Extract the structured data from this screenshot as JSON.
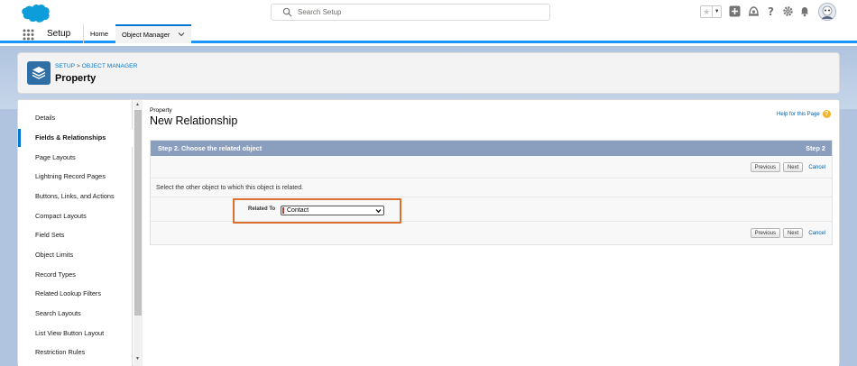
{
  "search": {
    "placeholder": "Search Setup"
  },
  "nav": {
    "app_name": "Setup",
    "tabs": [
      {
        "label": "Home"
      },
      {
        "label": "Object Manager"
      }
    ]
  },
  "header": {
    "breadcrumb_setup": "SETUP",
    "breadcrumb_sep": ">",
    "breadcrumb_om": "OBJECT MANAGER",
    "object_name": "Property"
  },
  "sidebar": {
    "items": [
      {
        "label": "Details"
      },
      {
        "label": "Fields & Relationships",
        "active": true
      },
      {
        "label": "Page Layouts"
      },
      {
        "label": "Lightning Record Pages"
      },
      {
        "label": "Buttons, Links, and Actions"
      },
      {
        "label": "Compact Layouts"
      },
      {
        "label": "Field Sets"
      },
      {
        "label": "Object Limits"
      },
      {
        "label": "Record Types"
      },
      {
        "label": "Related Lookup Filters"
      },
      {
        "label": "Search Layouts"
      },
      {
        "label": "List View Button Layout"
      },
      {
        "label": "Restriction Rules"
      }
    ]
  },
  "main": {
    "object_label": "Property",
    "page_title": "New Relationship",
    "help_link": "Help for this Page",
    "help_icon": "?",
    "step_title": "Step 2. Choose the related object",
    "step_number": "Step 2",
    "previous_label": "Previous",
    "next_label": "Next",
    "cancel_label": "Cancel",
    "instruction": "Select the other object to which this object is related.",
    "related_to_label": "Related To",
    "related_to_value": "Contact"
  },
  "colors": {
    "accent": "#0176d3",
    "step_header": "#8a9ebe",
    "highlight": "#d9702f",
    "required": "#c23934"
  }
}
